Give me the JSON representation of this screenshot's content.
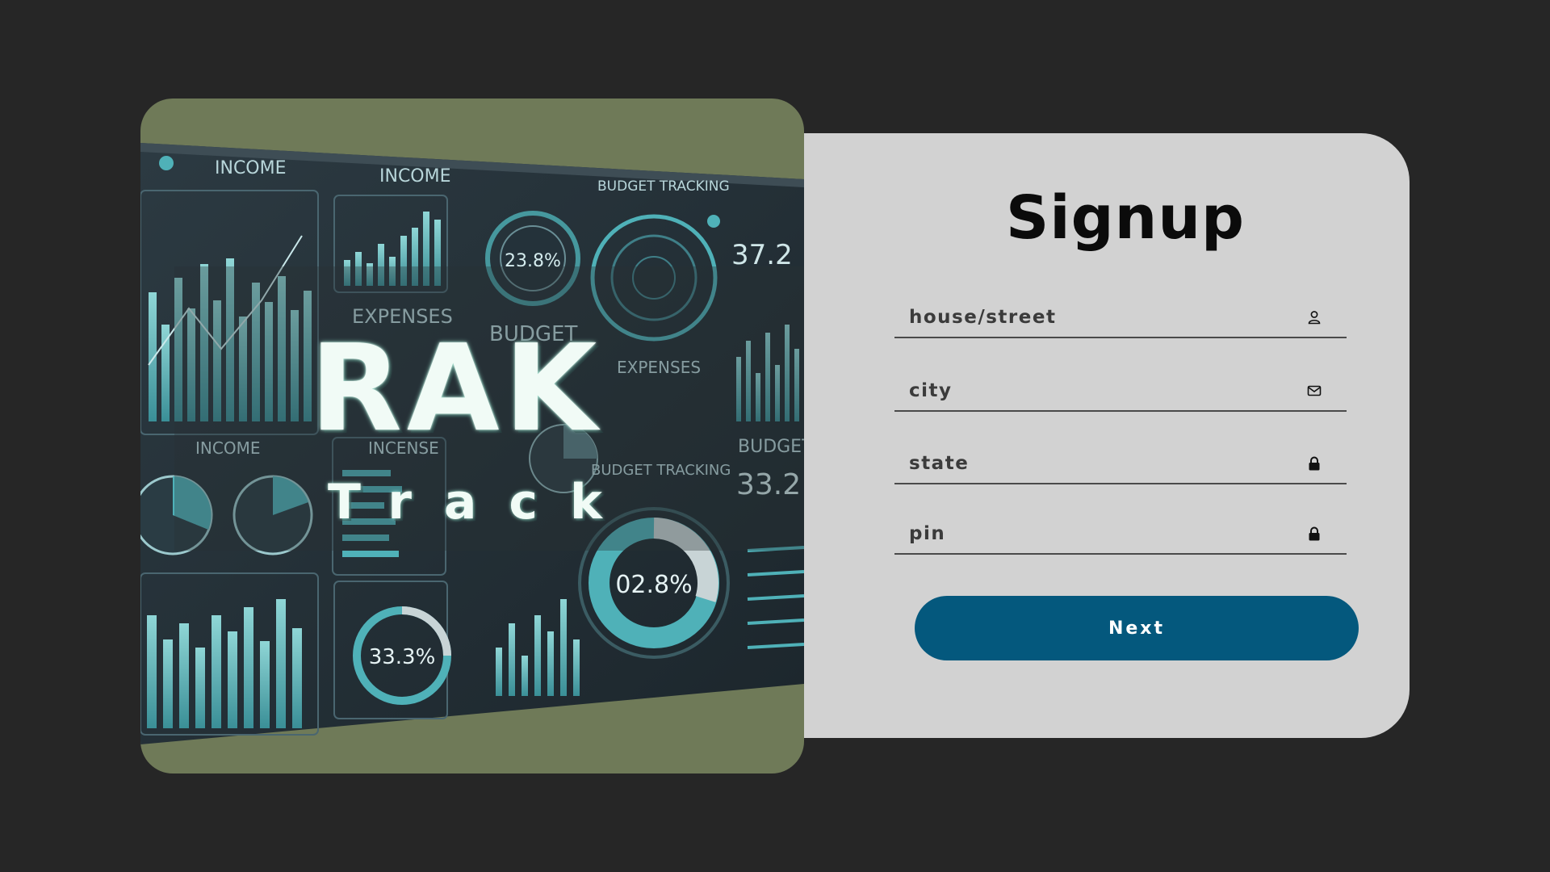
{
  "hero": {
    "brand_title": "RAK",
    "brand_sub": "Track",
    "art_labels": [
      "INCOME",
      "INCOME",
      "BUDGET TRACKING",
      "EXPENSES",
      "BUDGET",
      "EXPENSES",
      "INCOME",
      "INCENSE",
      "BUDGET TRACKING",
      "BUDGET",
      "33.3%",
      "02.8%",
      "23.8%",
      "37.2",
      "33.2"
    ]
  },
  "signup": {
    "title": "Signup",
    "fields": [
      {
        "placeholder": "house/street",
        "icon": "user-icon"
      },
      {
        "placeholder": "city",
        "icon": "mail-icon"
      },
      {
        "placeholder": "state",
        "icon": "lock-icon"
      },
      {
        "placeholder": "pin",
        "icon": "lock-icon"
      }
    ],
    "next_label": "Next"
  },
  "colors": {
    "background": "#262626",
    "card": "#d2d2d2",
    "button": "#04587d",
    "hero_backdrop": "#6f7a58",
    "teal": "#4fb1b8"
  }
}
